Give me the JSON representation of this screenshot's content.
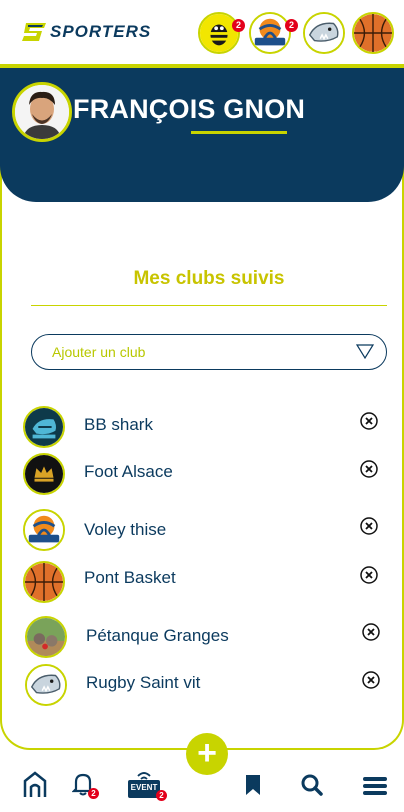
{
  "app": {
    "brand": "SPORTERS"
  },
  "header": {
    "clubs": [
      {
        "name": "wasp-club-icon",
        "badge": "2"
      },
      {
        "name": "volleyball-club-icon",
        "badge": "2"
      },
      {
        "name": "shark-club-icon",
        "badge": ""
      },
      {
        "name": "basketball-club-icon",
        "badge": ""
      }
    ]
  },
  "profile": {
    "name": "FRANÇOIS GNON"
  },
  "section": {
    "title": "Mes clubs suivis"
  },
  "add_club": {
    "placeholder": "Ajouter un club"
  },
  "clubs": [
    {
      "name": "BB shark",
      "logo": "shark-logo-icon"
    },
    {
      "name": "Foot Alsace",
      "logo": "crown-logo-icon"
    },
    {
      "name": "Voley thise",
      "logo": "volleyball-logo-icon"
    },
    {
      "name": "Pont Basket",
      "logo": "basketball-logo-icon"
    },
    {
      "name": "Pétanque Granges",
      "logo": "petanque-logo-icon"
    },
    {
      "name": "Rugby Saint vit",
      "logo": "shark-logo-icon"
    }
  ],
  "nav": {
    "notifications_badge": "2",
    "event_label": "EVENT",
    "event_badge": "2",
    "fab_label": "+"
  },
  "colors": {
    "primary": "#0b3a5e",
    "accent": "#c8d400",
    "badge": "#e3001b"
  }
}
